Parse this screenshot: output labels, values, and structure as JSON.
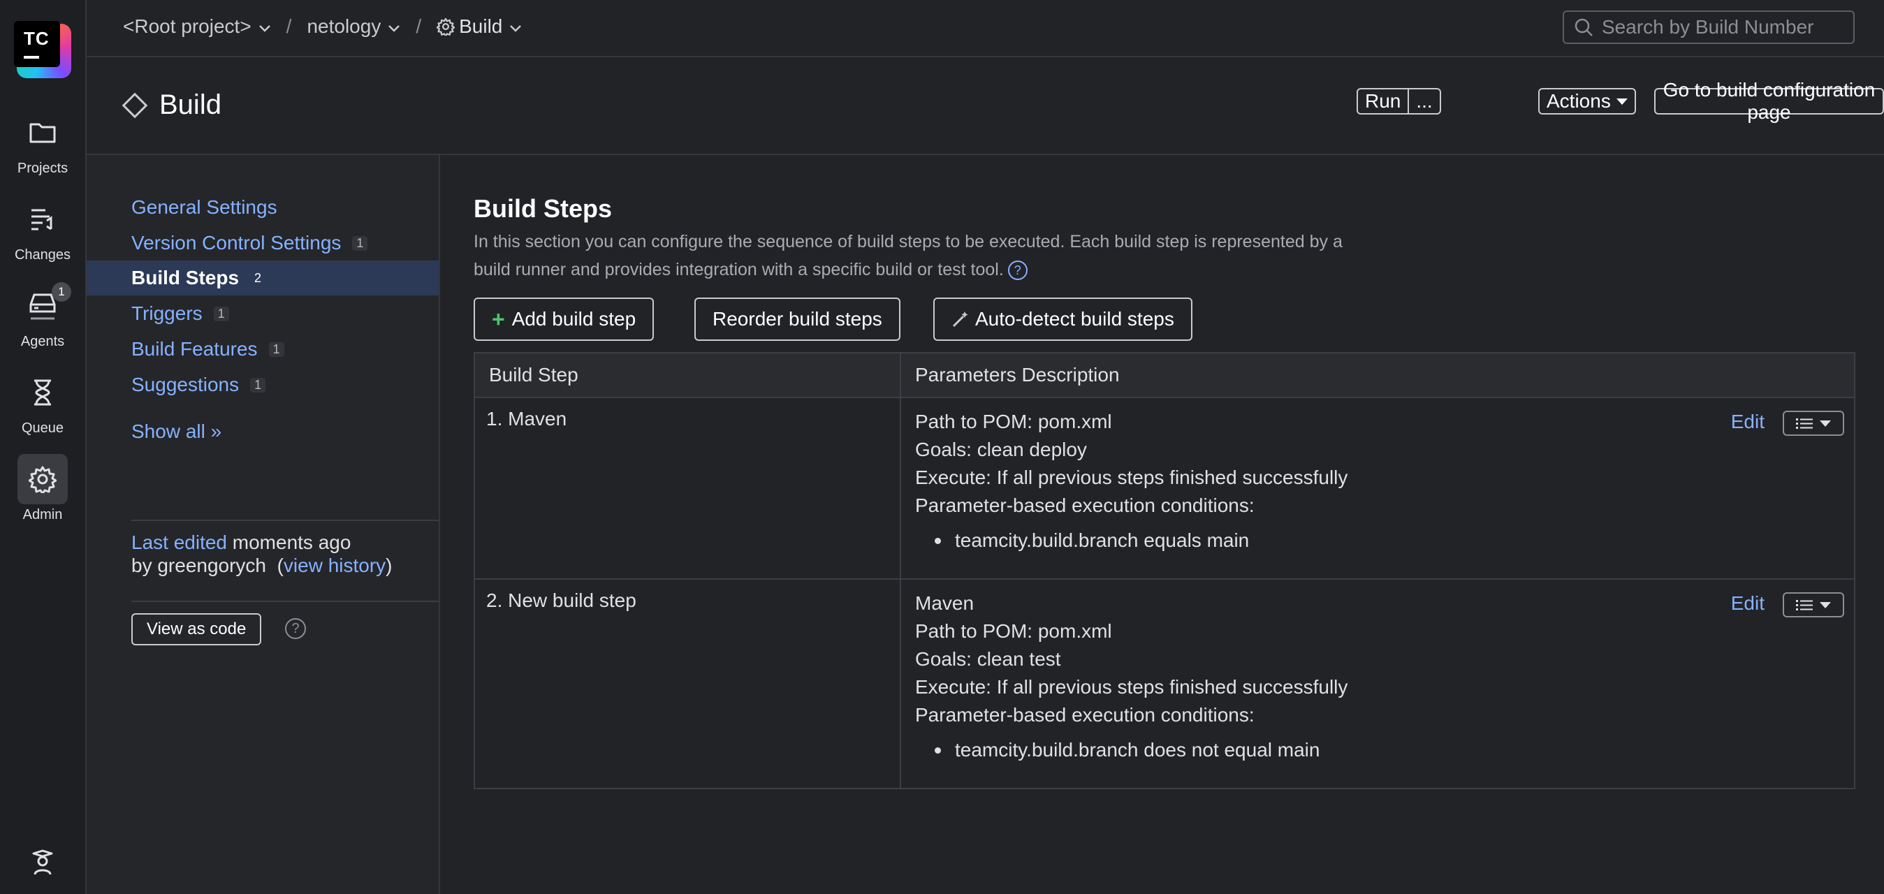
{
  "rail": {
    "logo_text": "TC",
    "items": [
      {
        "label": "Projects",
        "icon": "folder-icon"
      },
      {
        "label": "Changes",
        "icon": "changes-icon"
      },
      {
        "label": "Agents",
        "icon": "agents-icon",
        "badge": "1"
      },
      {
        "label": "Queue",
        "icon": "hourglass-icon"
      },
      {
        "label": "Admin",
        "icon": "gear-icon"
      }
    ],
    "bottom_icon": "help-assistant-icon"
  },
  "breadcrumbs": {
    "root": "<Root project>",
    "project": "netology",
    "config": "Build",
    "separator": "/"
  },
  "search": {
    "placeholder": "Search by Build Number"
  },
  "header": {
    "title": "Build",
    "run_label": "Run",
    "run_more_label": "...",
    "actions_label": "Actions",
    "goto_label": "Go to build configuration page"
  },
  "sidenav": {
    "items": [
      {
        "label": "General Settings",
        "count": ""
      },
      {
        "label": "Version Control Settings",
        "count": "1"
      },
      {
        "label": "Build Steps",
        "count": "2"
      },
      {
        "label": "Triggers",
        "count": "1"
      },
      {
        "label": "Build Features",
        "count": "1"
      },
      {
        "label": "Suggestions",
        "count": "1"
      }
    ],
    "show_all": "Show all »",
    "last_edited_link": "Last edited",
    "last_edited_time": "moments ago",
    "by_user": "by greengorych",
    "view_history": "view history",
    "view_as_code": "View as code"
  },
  "main": {
    "title": "Build Steps",
    "description": "In this section you can configure the sequence of build steps to be executed. Each build step is represented by a build runner and provides integration with a specific build or test tool.",
    "add_step": "Add build step",
    "reorder": "Reorder build steps",
    "autodetect": "Auto-detect build steps",
    "table": {
      "col_step": "Build Step",
      "col_params": "Parameters Description",
      "edit_label": "Edit",
      "rows": [
        {
          "name": "1. Maven",
          "lines": [
            "Path to POM: pom.xml",
            "Goals: clean deploy",
            "Execute: If all previous steps finished successfully",
            "Parameter-based execution conditions:"
          ],
          "condition": "teamcity.build.branch equals main"
        },
        {
          "name": "2. New build step",
          "lines": [
            "Maven",
            "Path to POM: pom.xml",
            "Goals: clean test",
            "Execute: If all previous steps finished successfully",
            "Parameter-based execution conditions:"
          ],
          "condition": "teamcity.build.branch does not equal main"
        }
      ]
    }
  }
}
